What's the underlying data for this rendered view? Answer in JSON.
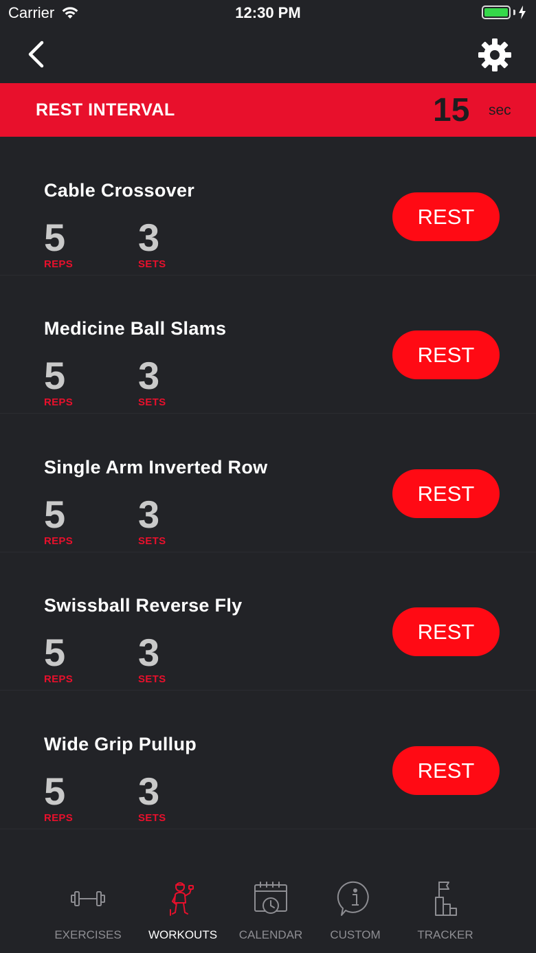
{
  "status_bar": {
    "carrier": "Carrier",
    "time": "12:30 PM"
  },
  "header": {
    "back_icon": "chevron-left-icon",
    "settings_icon": "gear-icon"
  },
  "rest_interval": {
    "label": "REST INTERVAL",
    "value": "15",
    "unit": "sec"
  },
  "exercises": [
    {
      "name": "Cable Crossover",
      "reps": "5",
      "reps_label": "REPS",
      "sets": "3",
      "sets_label": "SETS",
      "button": "REST"
    },
    {
      "name": "Medicine Ball Slams",
      "reps": "5",
      "reps_label": "REPS",
      "sets": "3",
      "sets_label": "SETS",
      "button": "REST"
    },
    {
      "name": "Single Arm Inverted Row",
      "reps": "5",
      "reps_label": "REPS",
      "sets": "3",
      "sets_label": "SETS",
      "button": "REST"
    },
    {
      "name": "Swissball Reverse Fly",
      "reps": "5",
      "reps_label": "REPS",
      "sets": "3",
      "sets_label": "SETS",
      "button": "REST"
    },
    {
      "name": "Wide Grip Pullup",
      "reps": "5",
      "reps_label": "REPS",
      "sets": "3",
      "sets_label": "SETS",
      "button": "REST"
    }
  ],
  "tab_bar": {
    "tabs": [
      {
        "label": "EXERCISES",
        "icon": "dumbbell-icon",
        "active": false
      },
      {
        "label": "WORKOUTS",
        "icon": "person-lifting-icon",
        "active": true
      },
      {
        "label": "CALENDAR",
        "icon": "calendar-clock-icon",
        "active": false
      },
      {
        "label": "CUSTOM",
        "icon": "info-bubble-icon",
        "active": false
      },
      {
        "label": "TRACKER",
        "icon": "flag-podium-icon",
        "active": false
      }
    ]
  },
  "colors": {
    "background": "#222327",
    "accent_red": "#e8102c",
    "button_red": "#ff0a14",
    "stat_gray": "#c9c9c9",
    "tab_inactive": "#8e8e93",
    "battery_green": "#35d84a"
  }
}
